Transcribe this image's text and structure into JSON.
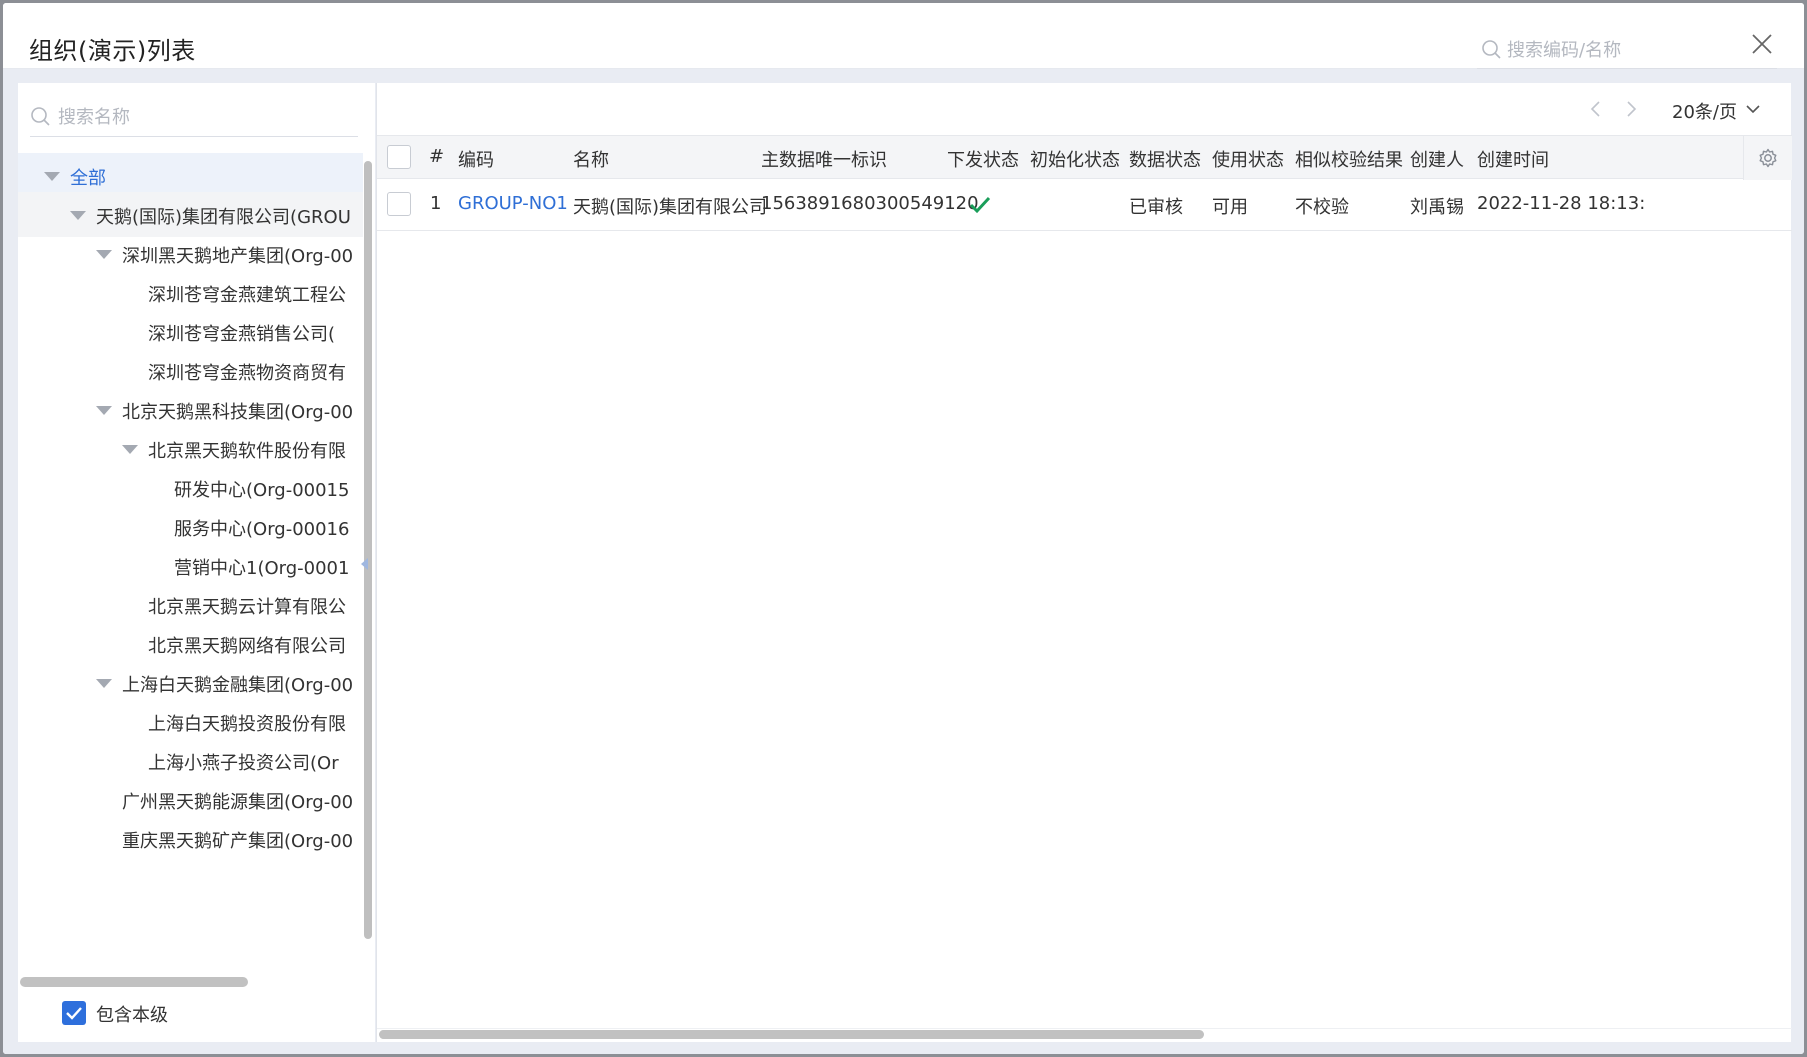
{
  "dialog": {
    "title": "组织(演示)列表",
    "search_placeholder": "搜索编码/名称"
  },
  "tree_panel": {
    "search_placeholder": "搜索名称",
    "nodes": [
      {
        "label": "全部",
        "level": 0,
        "expanded": true,
        "selected": true
      },
      {
        "label": "天鹅(国际)集团有限公司(GROU",
        "level": 1,
        "expanded": true
      },
      {
        "label": "深圳黑天鹅地产集团(Org-00",
        "level": 2,
        "expanded": true
      },
      {
        "label": "深圳苍穹金燕建筑工程公",
        "level": 3
      },
      {
        "label": "深圳苍穹金燕销售公司(",
        "level": 3
      },
      {
        "label": "深圳苍穹金燕物资商贸有",
        "level": 3
      },
      {
        "label": "北京天鹅黑科技集团(Org-00",
        "level": 2,
        "expanded": true
      },
      {
        "label": "北京黑天鹅软件股份有限",
        "level": 3,
        "expanded": true
      },
      {
        "label": "研发中心(Org-00015",
        "level": 4
      },
      {
        "label": "服务中心(Org-00016",
        "level": 4
      },
      {
        "label": "营销中心1(Org-0001",
        "level": 4
      },
      {
        "label": "北京黑天鹅云计算有限公",
        "level": 3
      },
      {
        "label": "北京黑天鹅网络有限公司",
        "level": 3
      },
      {
        "label": "上海白天鹅金融集团(Org-00",
        "level": 2,
        "expanded": true
      },
      {
        "label": "上海白天鹅投资股份有限",
        "level": 3
      },
      {
        "label": "上海小燕子投资公司(Or",
        "level": 3
      },
      {
        "label": "广州黑天鹅能源集团(Org-00",
        "level": 2
      },
      {
        "label": "重庆黑天鹅矿产集团(Org-00",
        "level": 2
      }
    ],
    "include_self_label": "包含本级",
    "include_self_checked": true
  },
  "pager": {
    "page_size_label": "20条/页"
  },
  "table": {
    "columns": [
      "#",
      "编码",
      "名称",
      "主数据唯一标识",
      "下发状态",
      "初始化状态",
      "数据状态",
      "使用状态",
      "相似校验结果",
      "创建人",
      "创建时间"
    ],
    "rows": [
      {
        "index": "1",
        "code": "GROUP-NO1",
        "name": "天鹅(国际)集团有限公司",
        "master_id": "1563891680300549120",
        "dispatch_status": "check-icon",
        "init_status": "",
        "data_status": "已审核",
        "use_status": "可用",
        "similarity_result": "不校验",
        "creator": "刘禹锡",
        "created_at": "2022-11-28 18:13:"
      }
    ]
  },
  "colors": {
    "accent": "#2f6fd6",
    "success": "#1a9e5a",
    "panel_bg": "#e9ecf3"
  }
}
